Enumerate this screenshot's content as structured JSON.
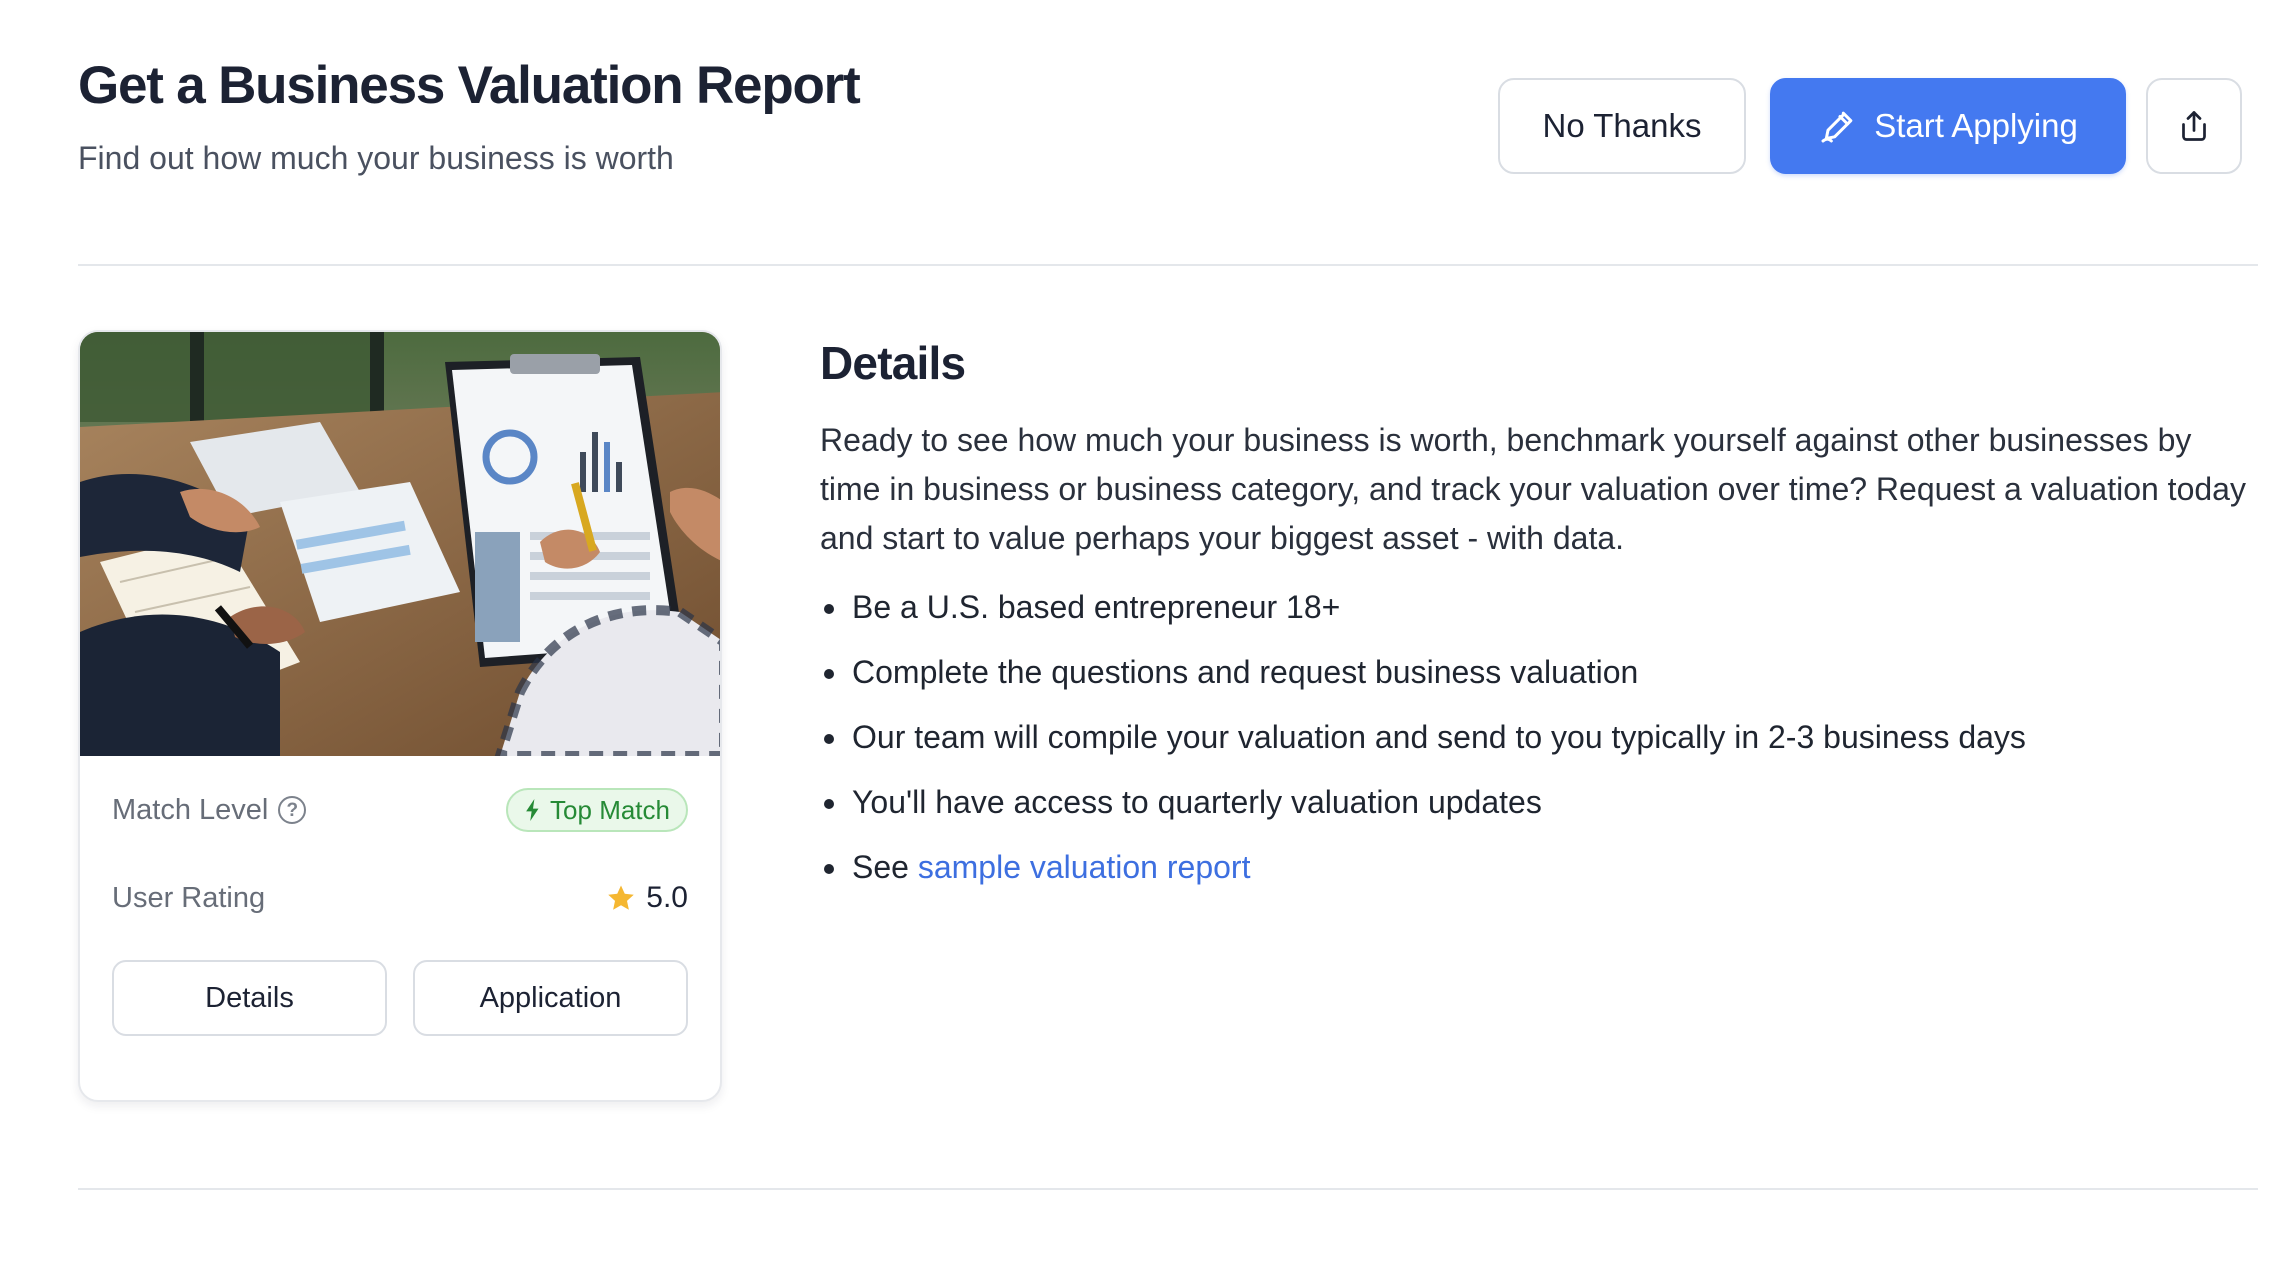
{
  "header": {
    "title": "Get a Business Valuation Report",
    "subtitle": "Find out how much your business is worth"
  },
  "actions": {
    "no_thanks_label": "No Thanks",
    "start_applying_label": "Start Applying",
    "start_icon": "pen-icon",
    "share_icon": "share-icon"
  },
  "card": {
    "match_level_label": "Match Level",
    "match_badge": "Top Match",
    "user_rating_label": "User Rating",
    "user_rating_value": "5.0",
    "details_button": "Details",
    "application_button": "Application"
  },
  "details": {
    "heading": "Details",
    "paragraph": "Ready to see how much your business is worth, benchmark yourself against other businesses by time in business or business category, and track your valuation over time? Request a valuation today and start to value perhaps your biggest asset - with data.",
    "bullets": [
      "Be a U.S. based entrepreneur 18+",
      "Complete the questions and request business valuation",
      "Our team will compile your valuation and send to you typically in 2-3 business days",
      "You'll have access to quarterly valuation updates"
    ],
    "last_bullet_prefix": "See",
    "sample_link": "sample valuation report"
  },
  "colors": {
    "primary": "#4479f0",
    "badge_green": "#268a36",
    "star": "#f5b731",
    "link": "#3d6fe0"
  }
}
